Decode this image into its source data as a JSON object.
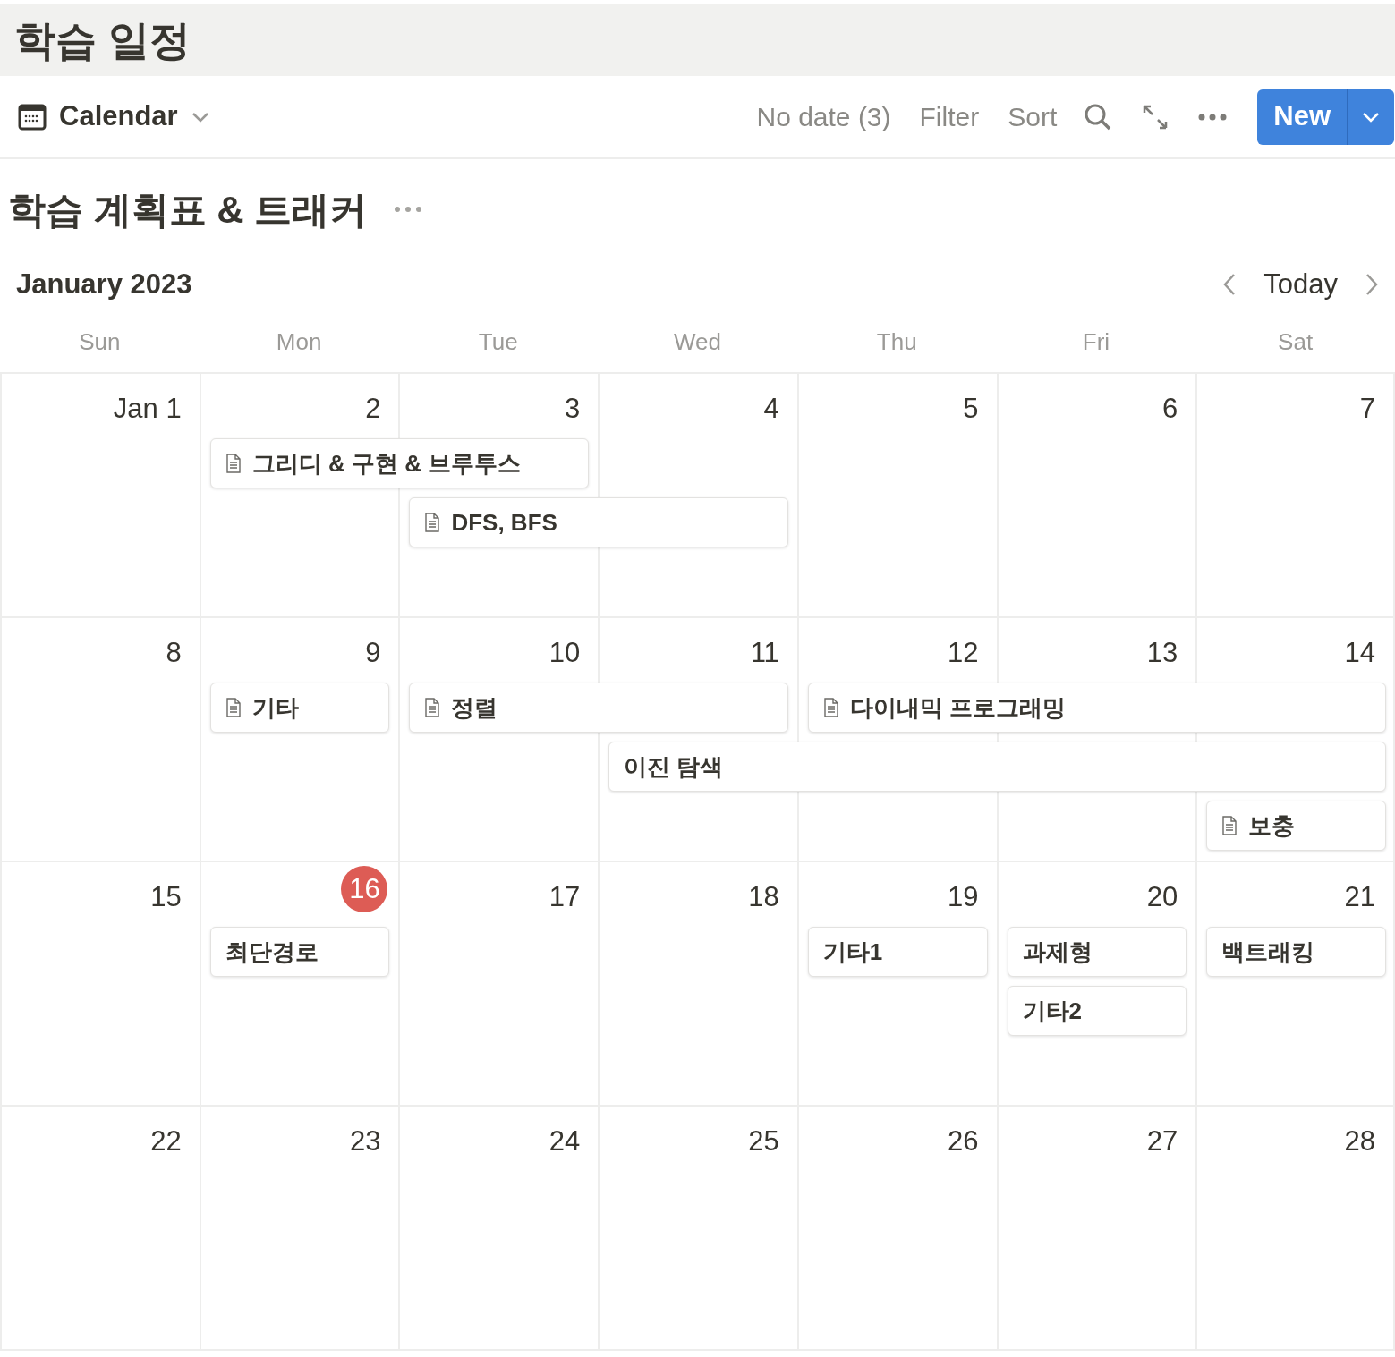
{
  "page_title": "학습 일정",
  "view": {
    "label": "Calendar"
  },
  "toolbar": {
    "no_date": "No date (3)",
    "filter": "Filter",
    "sort": "Sort",
    "new_button": "New"
  },
  "database_title": "학습 계획표 & 트래커",
  "calendar": {
    "month": "January 2023",
    "today_button": "Today",
    "weekdays": [
      "Sun",
      "Mon",
      "Tue",
      "Wed",
      "Thu",
      "Fri",
      "Sat"
    ],
    "weeks": [
      {
        "days": [
          {
            "label": "Jan 1",
            "today": false
          },
          {
            "label": "2",
            "today": false
          },
          {
            "label": "3",
            "today": false
          },
          {
            "label": "4",
            "today": false
          },
          {
            "label": "5",
            "today": false
          },
          {
            "label": "6",
            "today": false
          },
          {
            "label": "7",
            "today": false
          }
        ],
        "events": [
          {
            "title": "그리디 & 구현 & 브루투스",
            "page_icon": true
          },
          {
            "title": "DFS, BFS",
            "page_icon": true
          }
        ]
      },
      {
        "days": [
          {
            "label": "8",
            "today": false
          },
          {
            "label": "9",
            "today": false
          },
          {
            "label": "10",
            "today": false
          },
          {
            "label": "11",
            "today": false
          },
          {
            "label": "12",
            "today": false
          },
          {
            "label": "13",
            "today": false
          },
          {
            "label": "14",
            "today": false
          }
        ],
        "events": [
          {
            "title": "기타",
            "page_icon": true
          },
          {
            "title": "정렬",
            "page_icon": true
          },
          {
            "title": "다이내믹 프로그래밍",
            "page_icon": true
          },
          {
            "title": "이진 탐색",
            "page_icon": false
          },
          {
            "title": "보충",
            "page_icon": true
          }
        ]
      },
      {
        "days": [
          {
            "label": "15",
            "today": false
          },
          {
            "label": "16",
            "today": true
          },
          {
            "label": "17",
            "today": false
          },
          {
            "label": "18",
            "today": false
          },
          {
            "label": "19",
            "today": false
          },
          {
            "label": "20",
            "today": false
          },
          {
            "label": "21",
            "today": false
          }
        ],
        "events": [
          {
            "title": "최단경로",
            "page_icon": false
          },
          {
            "title": "기타1",
            "page_icon": false
          },
          {
            "title": "과제형",
            "page_icon": false
          },
          {
            "title": "기타2",
            "page_icon": false
          },
          {
            "title": "백트래킹",
            "page_icon": false
          }
        ]
      },
      {
        "days": [
          {
            "label": "22",
            "today": false
          },
          {
            "label": "23",
            "today": false
          },
          {
            "label": "24",
            "today": false
          },
          {
            "label": "25",
            "today": false
          },
          {
            "label": "26",
            "today": false
          },
          {
            "label": "27",
            "today": false
          },
          {
            "label": "28",
            "today": false
          }
        ]
      }
    ]
  }
}
